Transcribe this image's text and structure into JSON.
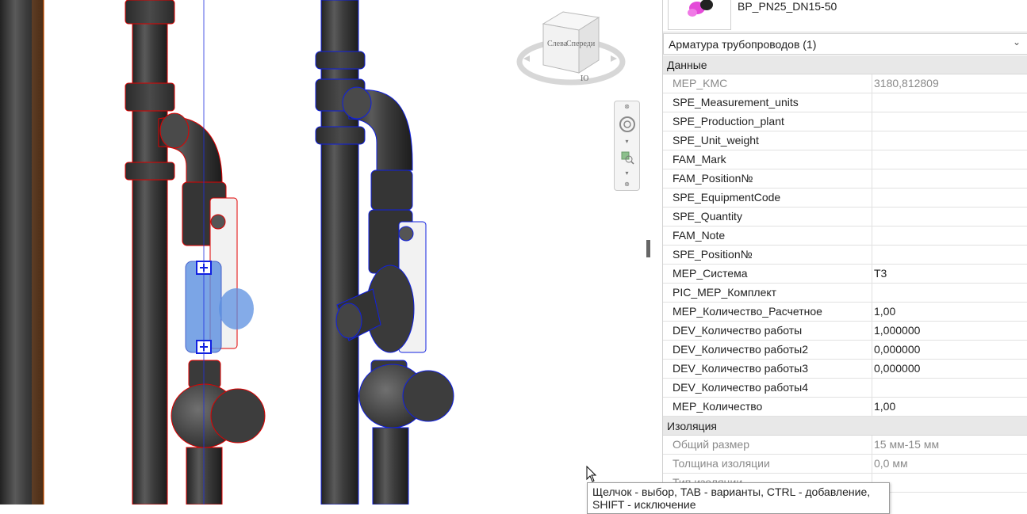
{
  "view_cube": {
    "left_label": "Слева",
    "front_label": "Спереди",
    "compass_label": "Ю"
  },
  "properties": {
    "type_name": "BP_PN25_DN15-50",
    "category_selector": "Арматура трубопроводов (1)",
    "groups": [
      {
        "title": "Данные",
        "rows": [
          {
            "name": "MEP_KMC",
            "value": "3180,812809",
            "readonly": true
          },
          {
            "name": "SPE_Measurement_units",
            "value": ""
          },
          {
            "name": "SPE_Production_plant",
            "value": ""
          },
          {
            "name": "SPE_Unit_weight",
            "value": ""
          },
          {
            "name": "FAM_Mark",
            "value": ""
          },
          {
            "name": "FAM_Position№",
            "value": ""
          },
          {
            "name": "SPE_EquipmentCode",
            "value": ""
          },
          {
            "name": "SPE_Quantity",
            "value": ""
          },
          {
            "name": "FAM_Note",
            "value": ""
          },
          {
            "name": "SPE_Position№",
            "value": ""
          },
          {
            "name": "MEP_Система",
            "value": "T3"
          },
          {
            "name": "PIC_MEP_Комплект",
            "value": ""
          },
          {
            "name": "MEP_Количество_Расчетное",
            "value": "1,00"
          },
          {
            "name": "DEV_Количество работы",
            "value": "1,000000"
          },
          {
            "name": "DEV_Количество работы2",
            "value": "0,000000"
          },
          {
            "name": "DEV_Количество работы3",
            "value": "0,000000"
          },
          {
            "name": "DEV_Количество работы4",
            "value": ""
          },
          {
            "name": "MEP_Количество",
            "value": "1,00"
          }
        ]
      },
      {
        "title": "Изоляция",
        "rows": [
          {
            "name": "Общий размер",
            "value": "15 мм-15 мм",
            "readonly": true
          },
          {
            "name": "Толщина изоляции",
            "value": "0,0 мм",
            "readonly": true
          },
          {
            "name": "Тип изоляции",
            "value": "",
            "readonly": true
          }
        ]
      }
    ]
  },
  "status_tooltip": {
    "line1": "Щелчок - выбор, TAB - варианты, CTRL - добавление,",
    "line2": "SHIFT - исключение"
  },
  "colors": {
    "pipe": "#3a3a3a",
    "selection_red": "#e00000",
    "selection_blue": "#1020e0",
    "highlight_blue": "#5b8fe0",
    "group_header_bg": "#e8e8e8"
  }
}
